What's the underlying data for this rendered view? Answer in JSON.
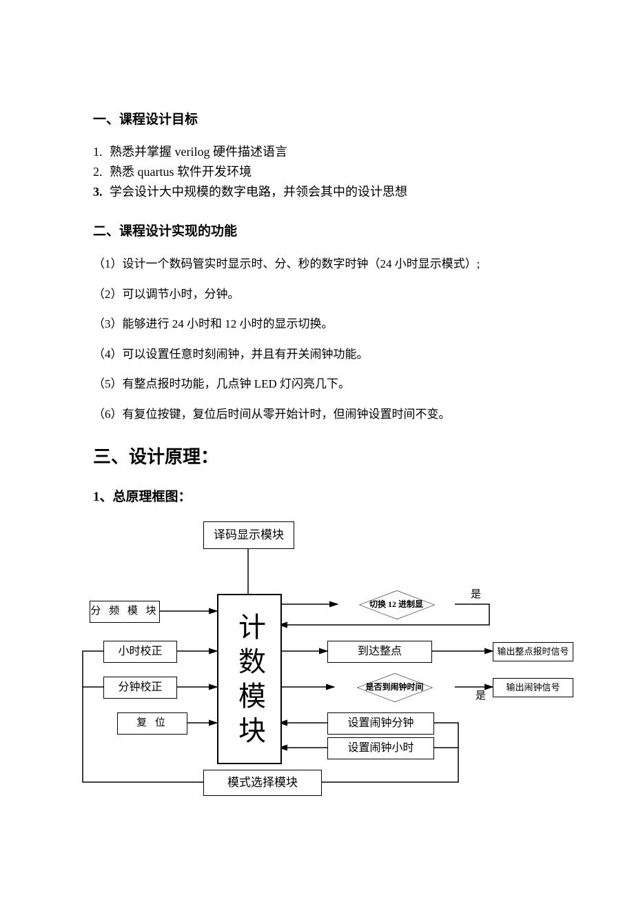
{
  "section1_title": "一、课程设计目标",
  "goals": [
    {
      "num": "1.",
      "text": "熟悉并掌握 verilog 硬件描述语言",
      "bold": false
    },
    {
      "num": "2.",
      "text": "熟悉 quartus 软件开发环境",
      "bold": false
    },
    {
      "num": "3.",
      "text": "学会设计大中规模的数字电路，并领会其中的设计思想",
      "bold": true
    }
  ],
  "section2_title": "二、课程设计实现的功能",
  "functions": [
    "（1）设计一个数码管实时显示时、分、秒的数字时钟（24 小时显示模式）;",
    "（2）可以调节小时，分钟。",
    "（3）能够进行 24 小时和 12 小时的显示切换。",
    "（4）可以设置任意时刻闹钟，并且有开关闹钟功能。",
    "（5）有整点报时功能，几点钟 LED 灯闪亮几下。",
    "（6）有复位按键，复位后时间从零开始计时，但闹钟设置时间不变。"
  ],
  "section3_title": "三、设计原理：",
  "section3_sub": "1、总原理框图：",
  "diagram": {
    "top_box": "译码显示模块",
    "center": "计数模块",
    "left": {
      "freq": "分 频 模 块",
      "hour_adj": "小时校正",
      "min_adj": "分钟校正",
      "reset": "复   位"
    },
    "right": {
      "switch12": "切换 12 进制显",
      "on_hour": "到达整点",
      "alarm_check": "是否到闹钟时间",
      "set_alarm_min": "设置闹钟分钟",
      "set_alarm_hour": "设置闹钟小时",
      "out_hour": "输出整点报时信号",
      "out_alarm": "输出闹钟信号"
    },
    "bottom": "模式选择模块",
    "yes1": "是",
    "yes2": "是"
  }
}
